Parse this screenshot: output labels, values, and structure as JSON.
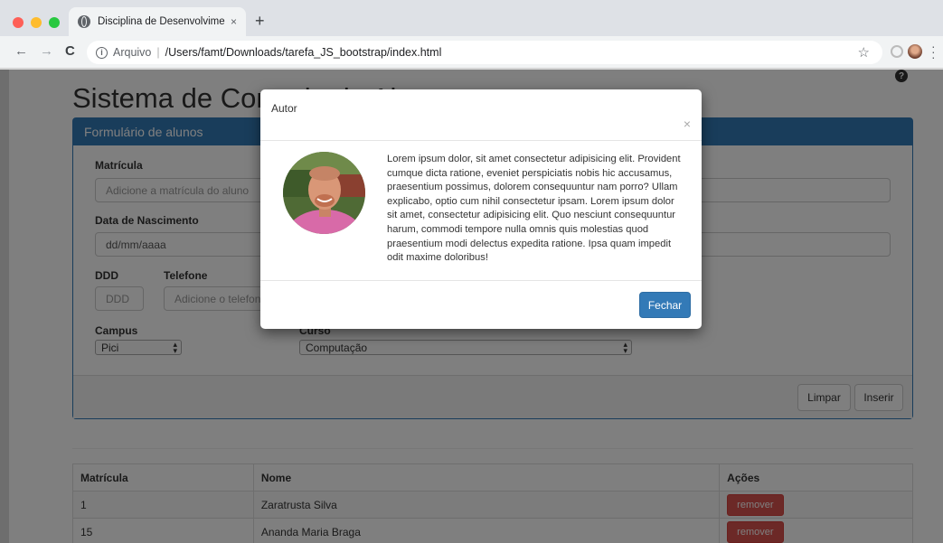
{
  "browser": {
    "tab_title": "Disciplina de Desenvolvimento",
    "tab_close": "×",
    "new_tab": "+",
    "scheme_label": "Arquivo",
    "url_separator": "|",
    "url": "/Users/famt/Downloads/tarefa_JS_bootstrap/index.html"
  },
  "page": {
    "title": "Sistema de Controle de Alunos",
    "help": "?",
    "panel_title": "Formulário de alunos",
    "form": {
      "matricula_label": "Matrícula",
      "matricula_placeholder": "Adicione a matrícula do aluno",
      "nascimento_label": "Data de Nascimento",
      "nascimento_value": "dd/mm/aaaa",
      "ddd_label": "DDD",
      "ddd_placeholder": "DDD",
      "telefone_label": "Telefone",
      "telefone_placeholder": "Adicione o telefone",
      "campus_label": "Campus",
      "campus_value": "Pici",
      "curso_label": "Curso",
      "curso_value": "Computação"
    },
    "buttons": {
      "limpar": "Limpar",
      "inserir": "Inserir"
    },
    "table": {
      "headers": [
        "Matrícula",
        "Nome",
        "Ações"
      ],
      "rows": [
        {
          "matricula": "1",
          "nome": "Zaratrusta Silva",
          "acao": "remover"
        },
        {
          "matricula": "15",
          "nome": "Ananda Maria Braga",
          "acao": "remover"
        }
      ]
    }
  },
  "modal": {
    "title": "Autor",
    "close": "×",
    "body": "Lorem ipsum dolor, sit amet consectetur adipisicing elit. Provident cumque dicta ratione, eveniet perspiciatis nobis hic accusamus, praesentium possimus, dolorem consequuntur nam porro? Ullam explicabo, optio cum nihil consectetur ipsam. Lorem ipsum dolor sit amet, consectetur adipisicing elit. Quo nesciunt consequuntur harum, commodi tempore nulla omnis quis molestias quod praesentium modi delectus expedita ratione. Ipsa quam impedit odit maxime doloribus!",
    "close_button": "Fechar"
  },
  "colors": {
    "primary": "#337ab7",
    "danger": "#d9534f",
    "backdrop": "rgba(0,0,0,0.5)"
  }
}
